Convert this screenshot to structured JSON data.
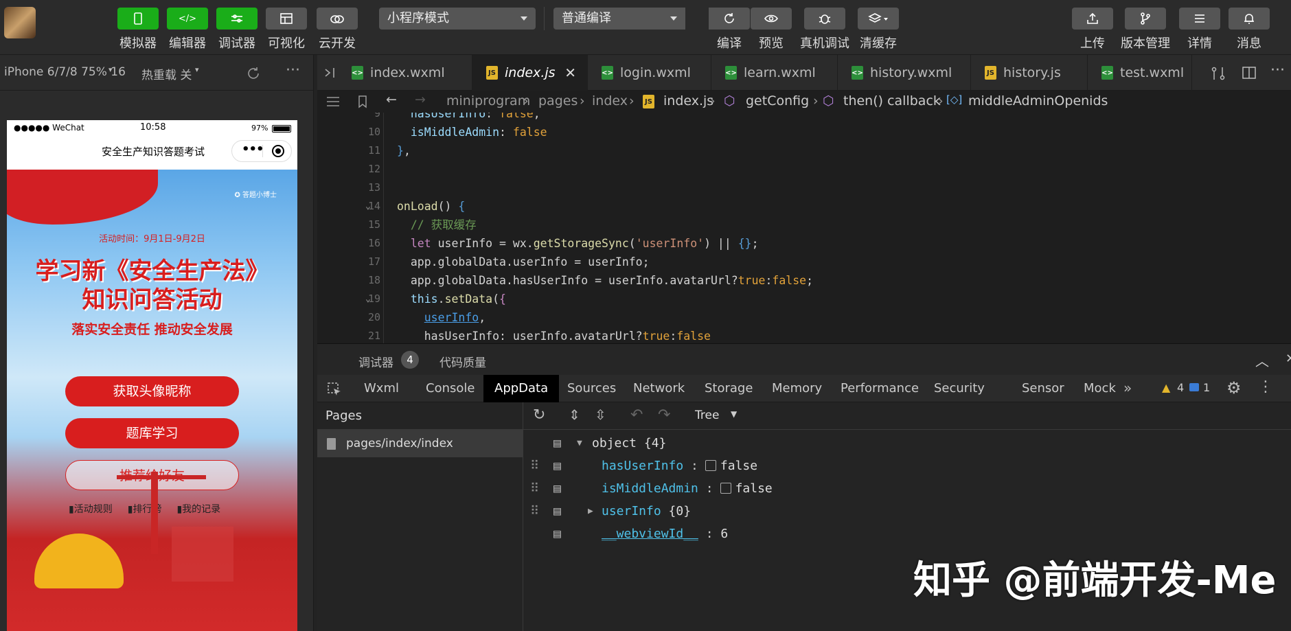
{
  "toolbar": {
    "modes": [
      {
        "label": "模拟器",
        "style": "green"
      },
      {
        "label": "编辑器",
        "style": "green"
      },
      {
        "label": "调试器",
        "style": "green"
      },
      {
        "label": "可视化",
        "style": "grey"
      },
      {
        "label": "云开发",
        "style": "grey"
      }
    ],
    "mode_select": "小程序模式",
    "compile_select": "普通编译",
    "actions": [
      "编译",
      "预览",
      "真机调试",
      "清缓存"
    ],
    "right_actions": [
      "上传",
      "版本管理",
      "详情",
      "消息"
    ]
  },
  "simulator": {
    "device": "iPhone 6/7/8 75% 16",
    "hot_reload": "热重载 关",
    "status": {
      "carrier": "●●●●● WeChat",
      "time": "10:58",
      "battery": "97%"
    },
    "nav_title": "安全生产知识答题考试",
    "poster": {
      "brand": "答题小博士",
      "date": "活动时间：9月1日-9月2日",
      "title_line1": "学习新《安全生产法》",
      "title_line2": "知识问答活动",
      "subtitle": "落实安全责任  推动安全发展",
      "buttons": [
        "获取头像昵称",
        "题库学习",
        "推荐给好友"
      ],
      "links": [
        "活动规则",
        "排行榜",
        "我的记录"
      ]
    }
  },
  "editor": {
    "tabs": [
      {
        "name": "index.wxml",
        "type": "wxml"
      },
      {
        "name": "index.js",
        "type": "js",
        "active": true
      },
      {
        "name": "login.wxml",
        "type": "wxml"
      },
      {
        "name": "learn.wxml",
        "type": "wxml"
      },
      {
        "name": "history.wxml",
        "type": "wxml"
      },
      {
        "name": "history.js",
        "type": "js"
      },
      {
        "name": "test.wxml",
        "type": "wxml"
      }
    ],
    "breadcrumb": [
      "miniprogram",
      "pages",
      "index",
      "index.js",
      "getConfig",
      "then() callback",
      "middleAdminOpenids"
    ],
    "line_numbers": [
      "9",
      "10",
      "11",
      "12",
      "13",
      "14",
      "15",
      "16",
      "17",
      "18",
      "19",
      "20",
      "21"
    ]
  },
  "debugger": {
    "title": "调试器",
    "badge": "4",
    "quality": "代码质量",
    "tabs": [
      "Wxml",
      "Console",
      "AppData",
      "Sources",
      "Network",
      "Storage",
      "Memory",
      "Performance",
      "Security",
      "Sensor",
      "Mock"
    ],
    "active_tab": "AppData",
    "warn_count": "4",
    "info_count": "1",
    "pages_header": "Pages",
    "page_item": "pages/index/index",
    "view_mode": "Tree",
    "tree": {
      "root": "object {4}",
      "items": [
        {
          "key": "hasUserInfo",
          "value": "false"
        },
        {
          "key": "isMiddleAdmin",
          "value": "false"
        },
        {
          "key": "userInfo",
          "value": "{0}"
        },
        {
          "key": "__webviewId__",
          "value": "6"
        }
      ]
    }
  },
  "watermark": "知乎 @前端开发-Me"
}
